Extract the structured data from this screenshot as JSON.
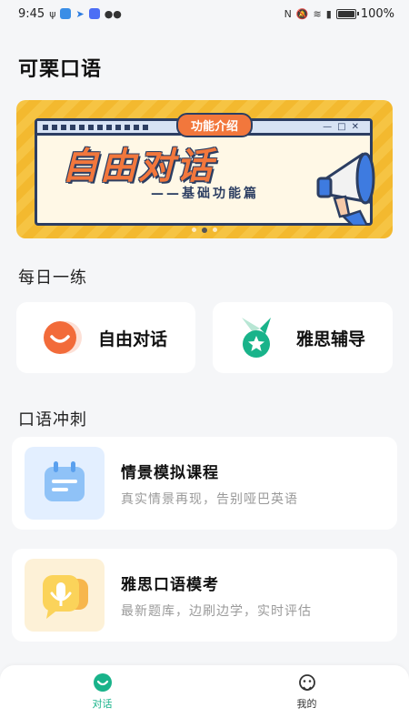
{
  "status_bar": {
    "time": "9:45",
    "battery": "100%"
  },
  "app": {
    "title": "可栗口语"
  },
  "banner": {
    "tag": "功能介绍",
    "headline": "自由对话",
    "subtitle": "——基础功能篇",
    "slide_count": 3,
    "active_slide": 1
  },
  "daily": {
    "section_title": "每日一练",
    "items": [
      {
        "label": "自由对话",
        "icon": "smile-icon"
      },
      {
        "label": "雅思辅导",
        "icon": "medal-icon"
      }
    ]
  },
  "sprint": {
    "section_title": "口语冲刺",
    "items": [
      {
        "title": "情景模拟课程",
        "desc": "真实情景再现，告别哑巴英语",
        "icon": "calendar-icon"
      },
      {
        "title": "雅思口语模考",
        "desc": "最新题库，边刷边学，实时评估",
        "icon": "microphone-chat-icon"
      }
    ]
  },
  "tab_bar": {
    "tabs": [
      {
        "label": "对话",
        "active": true
      },
      {
        "label": "我的",
        "active": false
      }
    ]
  },
  "colors": {
    "accent_green": "#19b38a",
    "banner_orange": "#f2773c",
    "banner_yellow": "#f6c443",
    "smile_orange": "#f26b3a"
  }
}
